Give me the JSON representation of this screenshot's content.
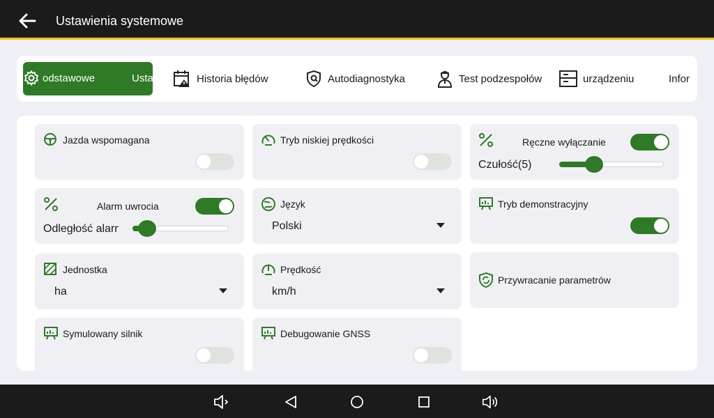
{
  "header": {
    "title": "Ustawienia systemowe"
  },
  "tabs": [
    {
      "label_a": "odstawowe",
      "label_b": "Usta",
      "active": true
    },
    {
      "label": "Historia błędów"
    },
    {
      "label": "Autodiagnostyka"
    },
    {
      "label": "Test podzespołów"
    },
    {
      "label": "urządzeniu"
    },
    {
      "label": "Infor"
    }
  ],
  "settings": {
    "assisted_driving": {
      "title": "Jazda wspomagana",
      "enabled": false
    },
    "low_speed_mode": {
      "title": "Tryb niskiej prędkości",
      "enabled": false
    },
    "manual_disengage": {
      "title": "Ręczne wyłączanie",
      "enabled": true,
      "sensitivity_label": "Czułość(5)",
      "sensitivity_fraction": 0.33
    },
    "turn_alarm": {
      "title": "Alarm uwrocia",
      "enabled": true,
      "distance_label": "Odległość alarm",
      "distance_fraction": 0.15
    },
    "language": {
      "title": "Język",
      "value": "Polski"
    },
    "demo_mode": {
      "title": "Tryb demonstracyjny",
      "enabled": true
    },
    "unit": {
      "title": "Jednostka",
      "value": "ha"
    },
    "speed": {
      "title": "Prędkość",
      "value": "km/h"
    },
    "restore": {
      "title": "Przywracanie parametrów"
    },
    "simulated_engine": {
      "title": "Symulowany silnik",
      "enabled": false
    },
    "gnss_debug": {
      "title": "Debugowanie GNSS",
      "enabled": false
    }
  },
  "colors": {
    "accent": "#2f7a26",
    "header_bg": "#1b1b1b",
    "header_line": "#f2c418",
    "card_bg": "#f0f0f4"
  }
}
